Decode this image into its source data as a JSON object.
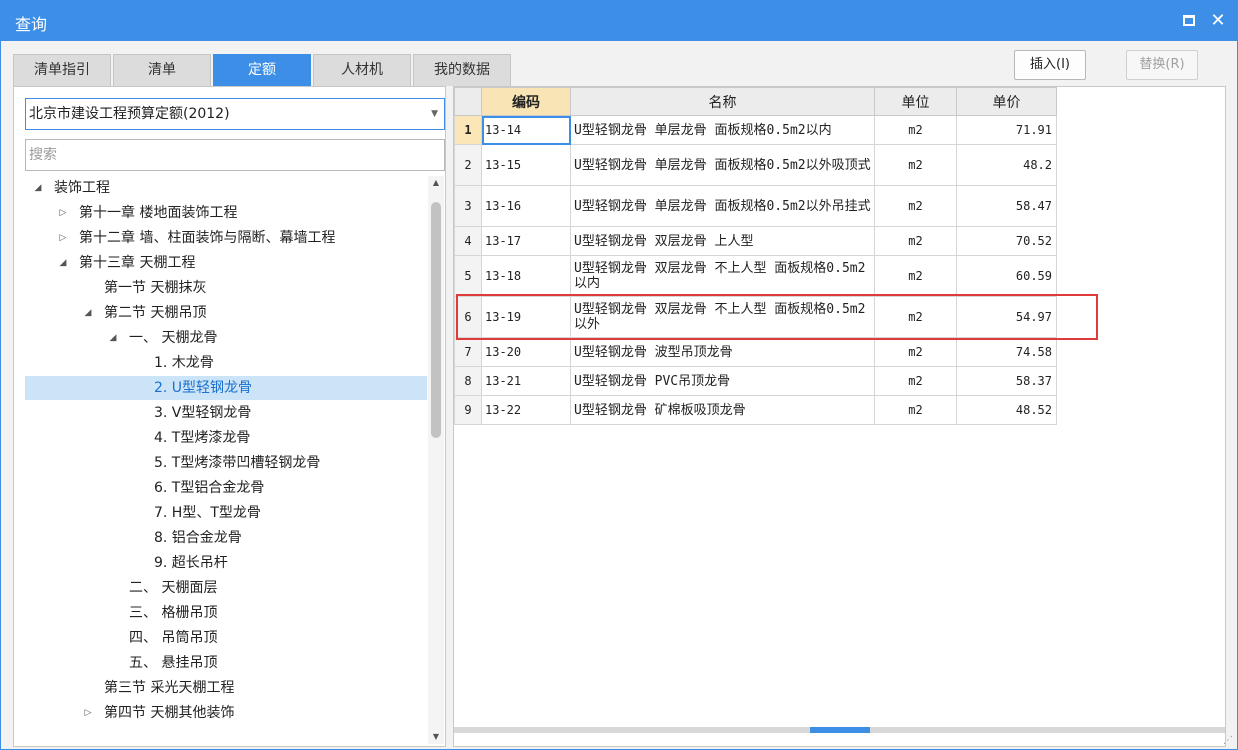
{
  "window": {
    "title": "查询"
  },
  "tabs": [
    {
      "label": "清单指引",
      "active": false
    },
    {
      "label": "清单",
      "active": false
    },
    {
      "label": "定额",
      "active": true
    },
    {
      "label": "人材机",
      "active": false
    },
    {
      "label": "我的数据",
      "active": false
    }
  ],
  "actions": {
    "insert_label": "插入(I)",
    "replace_label": "替换(R)"
  },
  "quota_select": {
    "value": "北京市建设工程预算定额(2012)"
  },
  "search": {
    "placeholder": "搜索",
    "value": ""
  },
  "tree": [
    {
      "label": "装饰工程",
      "level": 0,
      "expander": "expanded"
    },
    {
      "label": "第十一章 楼地面装饰工程",
      "level": 1,
      "expander": "collapsed"
    },
    {
      "label": "第十二章 墙、柱面装饰与隔断、幕墙工程",
      "level": 1,
      "expander": "collapsed"
    },
    {
      "label": "第十三章 天棚工程",
      "level": 1,
      "expander": "expanded"
    },
    {
      "label": "第一节 天棚抹灰",
      "level": 2,
      "expander": "none"
    },
    {
      "label": "第二节 天棚吊顶",
      "level": 2,
      "expander": "expanded"
    },
    {
      "label": "一、 天棚龙骨",
      "level": 3,
      "expander": "expanded"
    },
    {
      "label": "1. 木龙骨",
      "level": 4,
      "expander": "none"
    },
    {
      "label": "2. U型轻钢龙骨",
      "level": 4,
      "expander": "none",
      "selected": true
    },
    {
      "label": "3. V型轻钢龙骨",
      "level": 4,
      "expander": "none"
    },
    {
      "label": "4. T型烤漆龙骨",
      "level": 4,
      "expander": "none"
    },
    {
      "label": "5. T型烤漆带凹槽轻钢龙骨",
      "level": 4,
      "expander": "none"
    },
    {
      "label": "6. T型铝合金龙骨",
      "level": 4,
      "expander": "none"
    },
    {
      "label": "7. H型、T型龙骨",
      "level": 4,
      "expander": "none"
    },
    {
      "label": "8. 铝合金龙骨",
      "level": 4,
      "expander": "none"
    },
    {
      "label": "9. 超长吊杆",
      "level": 4,
      "expander": "none"
    },
    {
      "label": "二、 天棚面层",
      "level": 3,
      "expander": "none"
    },
    {
      "label": "三、 格栅吊顶",
      "level": 3,
      "expander": "none"
    },
    {
      "label": "四、 吊筒吊顶",
      "level": 3,
      "expander": "none"
    },
    {
      "label": "五、 悬挂吊顶",
      "level": 3,
      "expander": "none"
    },
    {
      "label": "第三节 采光天棚工程",
      "level": 2,
      "expander": "none"
    },
    {
      "label": "第四节 天棚其他装饰",
      "level": 2,
      "expander": "collapsed"
    }
  ],
  "table": {
    "columns": [
      "编码",
      "名称",
      "单位",
      "单价"
    ],
    "rows": [
      {
        "idx": "1",
        "code": "13-14",
        "name": "U型轻钢龙骨 单层龙骨 面板规格0.5m2以内",
        "unit": "m2",
        "price": "71.91"
      },
      {
        "idx": "2",
        "code": "13-15",
        "name": "U型轻钢龙骨 单层龙骨 面板规格0.5m2以外吸顶式",
        "unit": "m2",
        "price": "48.2"
      },
      {
        "idx": "3",
        "code": "13-16",
        "name": "U型轻钢龙骨 单层龙骨 面板规格0.5m2以外吊挂式",
        "unit": "m2",
        "price": "58.47"
      },
      {
        "idx": "4",
        "code": "13-17",
        "name": "U型轻钢龙骨 双层龙骨 上人型",
        "unit": "m2",
        "price": "70.52"
      },
      {
        "idx": "5",
        "code": "13-18",
        "name": "U型轻钢龙骨 双层龙骨 不上人型 面板规格0.5m2以内",
        "unit": "m2",
        "price": "60.59"
      },
      {
        "idx": "6",
        "code": "13-19",
        "name": "U型轻钢龙骨 双层龙骨 不上人型 面板规格0.5m2以外",
        "unit": "m2",
        "price": "54.97"
      },
      {
        "idx": "7",
        "code": "13-20",
        "name": "U型轻钢龙骨 波型吊顶龙骨",
        "unit": "m2",
        "price": "74.58"
      },
      {
        "idx": "8",
        "code": "13-21",
        "name": "U型轻钢龙骨 PVC吊顶龙骨",
        "unit": "m2",
        "price": "58.37"
      },
      {
        "idx": "9",
        "code": "13-22",
        "name": "U型轻钢龙骨 矿棉板吸顶龙骨",
        "unit": "m2",
        "price": "48.52"
      }
    ]
  },
  "colors": {
    "accent": "#3d8ee6",
    "highlight": "#e03b3b",
    "selected_row": "#cce4f7",
    "sorted_header": "#f9e4b5"
  }
}
